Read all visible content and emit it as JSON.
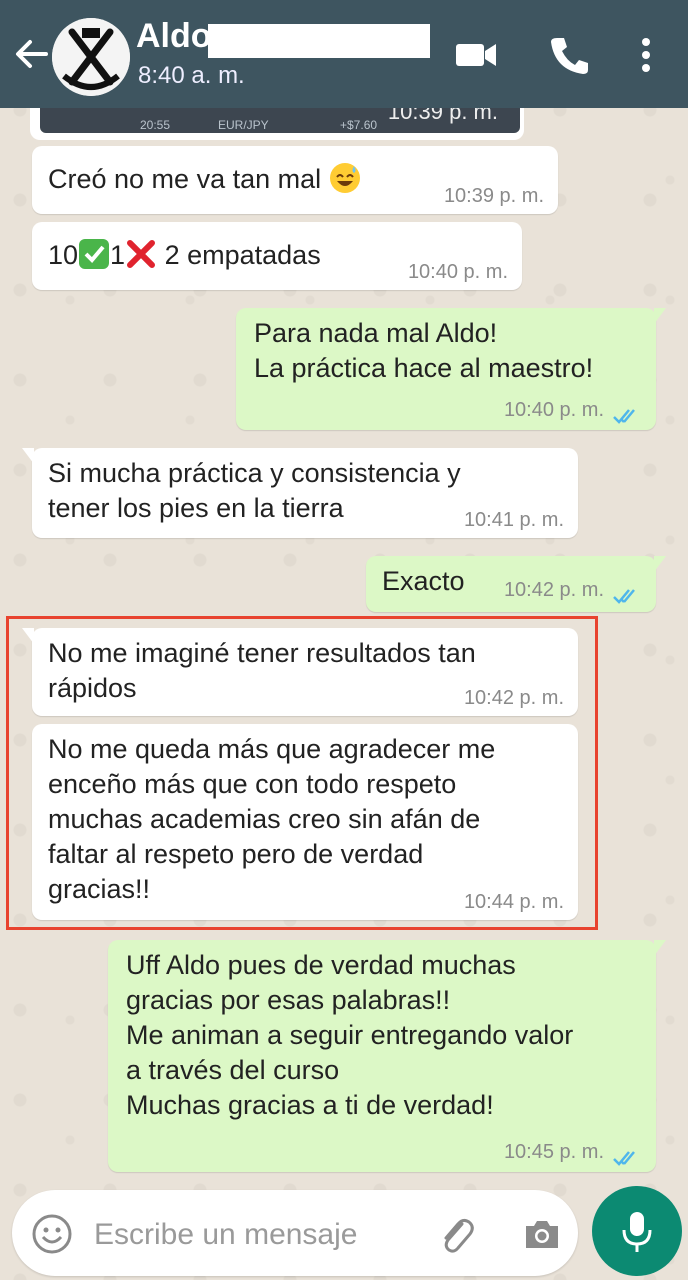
{
  "header": {
    "contact_name": "Aldo",
    "status": "8:40 a. m."
  },
  "image_message": {
    "partial_text_1": "20:55",
    "partial_text_2": "EUR/JPY",
    "partial_text_3": "+$7.60",
    "time": "10:39 p. m."
  },
  "messages": [
    {
      "direction": "in",
      "text": "Creó no me va tan mal",
      "emoji": "sweat-smile",
      "time": "10:39 p. m."
    },
    {
      "direction": "in",
      "parts": [
        "10",
        "1",
        "2 empatadas"
      ],
      "emojis": [
        "check-mark-button",
        "cross-mark"
      ],
      "time": "10:40 p. m."
    },
    {
      "direction": "out",
      "text": "Para nada mal Aldo!\nLa práctica hace al maestro!",
      "time": "10:40 p. m.",
      "read": true
    },
    {
      "direction": "in",
      "text": "Si mucha práctica y consistencia y\ntener los pies en la tierra",
      "time": "10:41 p. m."
    },
    {
      "direction": "out",
      "text": "Exacto",
      "time": "10:42 p. m.",
      "read": true
    },
    {
      "direction": "in",
      "text": "No me imaginé tener resultados tan\nrápidos",
      "time": "10:42 p. m."
    },
    {
      "direction": "in",
      "text": "No me queda más que agradecer me\nenceño más que con todo respeto\nmuchas academias creo sin afán de\nfaltar al respeto pero de verdad\ngracias!!",
      "time": "10:44 p. m."
    },
    {
      "direction": "out",
      "text": "Uff Aldo pues de verdad muchas\ngracias por esas palabras!!\nMe animan a seguir entregando valor\na través del curso\nMuchas gracias a ti de verdad!",
      "time": "10:45 p. m.",
      "read": true
    }
  ],
  "input": {
    "placeholder": "Escribe un mensaje"
  },
  "colors": {
    "header": "#3e5560",
    "incoming_bubble": "#ffffff",
    "outgoing_bubble": "#dcf8c6",
    "read_ticks": "#4fb6ec",
    "highlight_border": "#e8432f",
    "mic_button": "#0c8a72"
  },
  "icons": {
    "back": "arrow-left-icon",
    "video": "video-call-icon",
    "call": "phone-icon",
    "more": "more-vert-icon",
    "emoji": "emoji-icon",
    "attach": "paperclip-icon",
    "camera": "camera-icon",
    "mic": "microphone-icon"
  }
}
